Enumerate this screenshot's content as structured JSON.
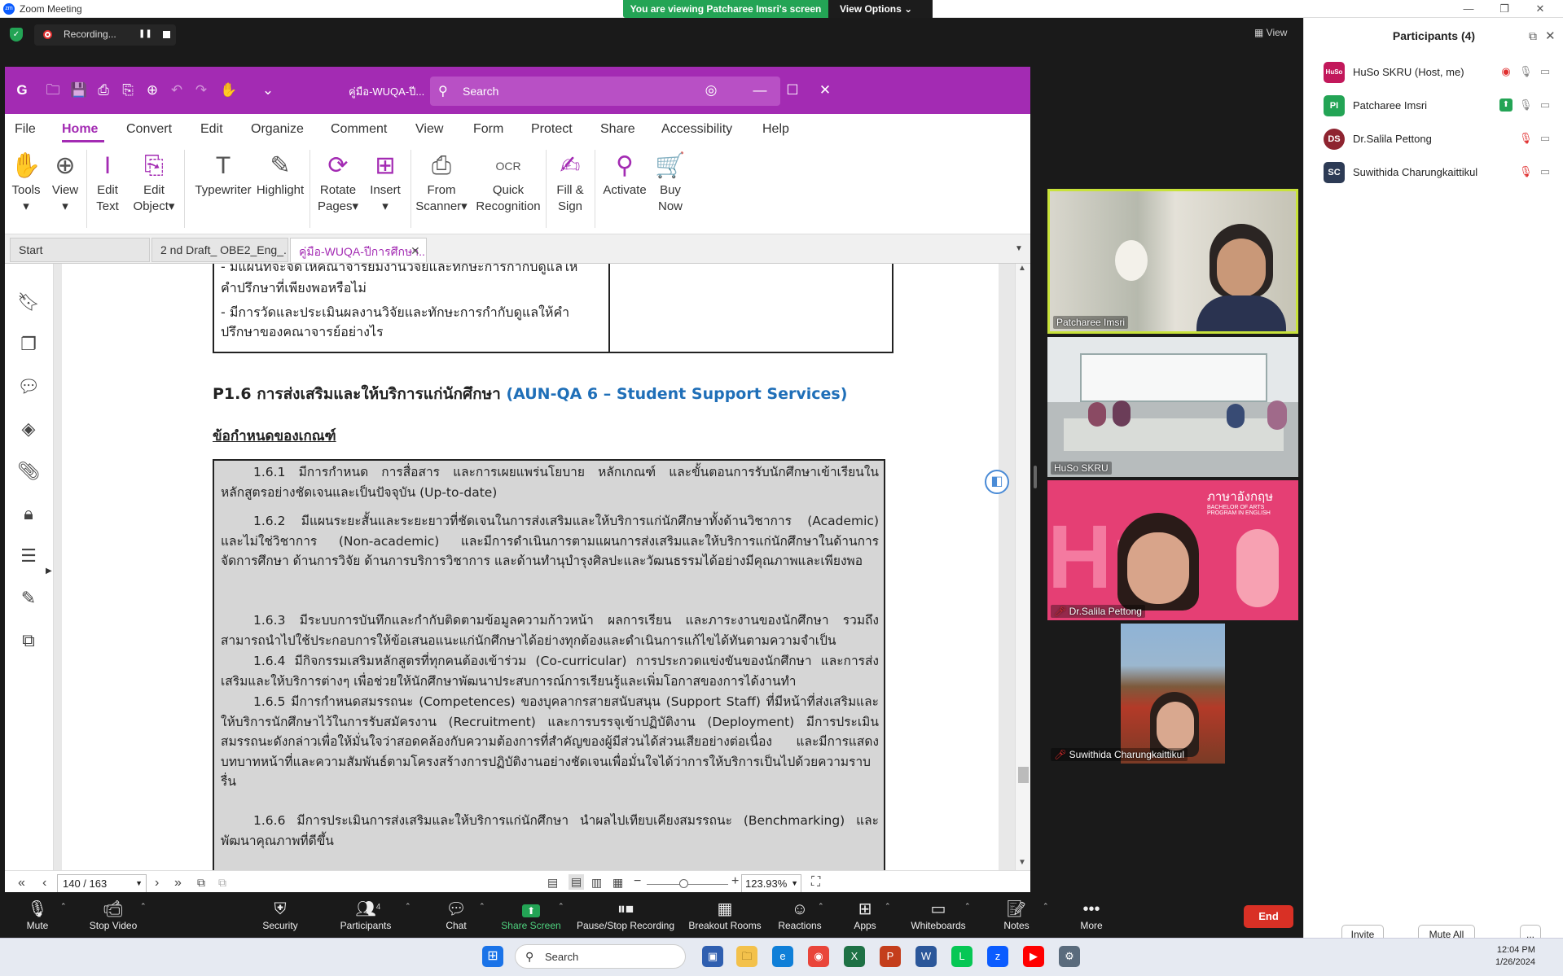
{
  "zoom": {
    "window_title": "Zoom Meeting",
    "logo_text": "zm",
    "banner_text": "You are viewing Patcharee Imsri's screen",
    "view_options": "View Options",
    "recording_label": "Recording...",
    "view_label": "View"
  },
  "foxit": {
    "filename": "คู่มือ-WUQA-ปี...",
    "search_placeholder": "Search",
    "menu": [
      "File",
      "Home",
      "Convert",
      "Edit",
      "Organize",
      "Comment",
      "View",
      "Form",
      "Protect",
      "Share",
      "Accessibility",
      "Help"
    ],
    "ribbon": [
      {
        "label1": "Tools",
        "label2": "▾",
        "icon": "✋"
      },
      {
        "label1": "View",
        "label2": "▾",
        "icon": "⊕"
      },
      {
        "label1": "Edit",
        "label2": "Text",
        "icon": "I"
      },
      {
        "label1": "Edit",
        "label2": "Object▾",
        "icon": "⎘"
      },
      {
        "label1": "Typewriter",
        "label2": "",
        "icon": "T"
      },
      {
        "label1": "Highlight",
        "label2": "",
        "icon": "✎"
      },
      {
        "label1": "Rotate",
        "label2": "Pages▾",
        "icon": "⟳"
      },
      {
        "label1": "Insert",
        "label2": "▾",
        "icon": "⊞"
      },
      {
        "label1": "From",
        "label2": "Scanner▾",
        "icon": "⎙"
      },
      {
        "label1": "Quick",
        "label2": "Recognition",
        "icon": "OCR"
      },
      {
        "label1": "Fill &",
        "label2": "Sign",
        "icon": "✍"
      },
      {
        "label1": "Activate",
        "label2": "",
        "icon": "⚲"
      },
      {
        "label1": "Buy",
        "label2": "Now",
        "icon": "🛒"
      }
    ],
    "tabs": [
      "Start",
      "2 nd Draft_ OBE2_Eng_...",
      "คู่มือ-WUQA-ปีการศึกษา..."
    ],
    "page_nav": "140 / 163",
    "zoom_level": "123.93%"
  },
  "document": {
    "prev_lines": [
      "- มีแผนที่จะจัดให้คณาจารย์มีงานวิจัยและทักษะการกำกับดูแลให้",
      "คำปรึกษาที่เพียงพอหรือไม่",
      "- มีการวัดและประเมินผลงานวิจัยและทักษะการกำกับดูแลให้คำ",
      "ปรึกษาของคณาจารย์อย่างไร"
    ],
    "section_title_th": "P1.6 การส่งเสริมและให้บริการแก่นักศึกษา",
    "section_title_en": "(AUN-QA 6 – Student Support Services)",
    "criteria_heading": "ข้อกำหนดของเกณฑ์",
    "criteria": [
      "1.6.1 มีการกำหนด การสื่อสาร และการเผยแพร่นโยบาย หลักเกณฑ์ และขั้นตอนการรับนักศึกษาเข้าเรียนในหลักสูตรอย่างชัดเจนและเป็นปัจจุบัน (Up-to-date)",
      "1.6.2 มีแผนระยะสั้นและระยะยาวที่ชัดเจนในการส่งเสริมและให้บริการแก่นักศึกษาทั้งด้านวิชาการ (Academic) และไม่ใช่วิชาการ (Non-academic) และมีการดำเนินการตามแผนการส่งเสริมและให้บริการแก่นักศึกษาในด้านการจัดการศึกษา ด้านการวิจัย ด้านการบริการวิชาการ และด้านทำนุบำรุงศิลปะและวัฒนธรรมได้อย่างมีคุณภาพและเพียงพอ",
      "1.6.3 มีระบบการบันทึกและกำกับติดตามข้อมูลความก้าวหน้า ผลการเรียน และภาระงานของนักศึกษา รวมถึงสามารถนำไปใช้ประกอบการให้ข้อเสนอแนะแก่นักศึกษาได้อย่างทุกต้องและดำเนินการแก้ไขได้ทันตามความจำเป็น",
      "1.6.4 มีกิจกรรมเสริมหลักสูตรที่ทุกคนต้องเข้าร่วม (Co-curricular) การประกวดแข่งขันของนักศึกษา และการส่งเสริมและให้บริการต่างๆ เพื่อช่วยให้นักศึกษาพัฒนาประสบการณ์การเรียนรู้และเพิ่มโอกาสของการได้งานทำ",
      "1.6.5 มีการกำหนดสมรรถนะ (Competences) ของบุคลากรสายสนับสนุน (Support Staff) ที่มีหน้าที่ส่งเสริมและให้บริการนักศึกษาไว้ในการรับสมัครงาน (Recruitment) และการบรรจุเข้าปฏิบัติงาน (Deployment) มีการประเมินสมรรถนะดังกล่าวเพื่อให้มั่นใจว่าสอดคล้องกับความต้องการที่สำคัญของผู้มีส่วนได้ส่วนเสียอย่างต่อเนื่อง และมีการแสดงบทบาทหน้าที่และความสัมพันธ์ตามโครงสร้างการปฏิบัติงานอย่างชัดเจนเพื่อมั่นใจได้ว่าการให้บริการเป็นไปด้วยความราบรื่น",
      "1.6.6 มีการประเมินการส่งเสริมและให้บริการแก่นักศึกษา นำผลไปเทียบเคียงสมรรถนะ (Benchmarking) และพัฒนาคุณภาพที่ดีขึ้น"
    ]
  },
  "participants": {
    "title": "Participants (4)",
    "list": [
      {
        "initials": "HuSo",
        "name": "HuSo SKRU (Host, me)",
        "color": "#c2185b"
      },
      {
        "initials": "PI",
        "name": "Patcharee Imsri",
        "color": "#23a455"
      },
      {
        "initials": "DS",
        "name": "Dr.Salila Pettong",
        "color": "#8e2430"
      },
      {
        "initials": "SC",
        "name": "Suwithida Charungkaittikul",
        "color": "#2d3b55"
      }
    ],
    "invite": "Invite",
    "mute_all": "Mute All",
    "more": "..."
  },
  "videos": {
    "tile1": "Patcharee Imsri",
    "tile2": "HuSo SKRU",
    "tile3": "Dr.Salila Pettong",
    "tile4": "Suwithida Charungkaittikul",
    "tile3_banner_th": "ภาษาอังกฤษ",
    "tile3_banner_en": "BACHELOR OF ARTS PROGRAM IN ENGLISH"
  },
  "toolbar": {
    "mute": "Mute",
    "stop_video": "Stop Video",
    "security": "Security",
    "participants": "Participants",
    "participants_count": "4",
    "chat": "Chat",
    "share": "Share Screen",
    "pause_rec": "Pause/Stop Recording",
    "breakout": "Breakout Rooms",
    "reactions": "Reactions",
    "apps": "Apps",
    "whiteboards": "Whiteboards",
    "notes": "Notes",
    "more": "More",
    "end": "End"
  },
  "taskbar": {
    "search": "Search",
    "time": "12:04 PM",
    "date": "1/26/2024"
  }
}
